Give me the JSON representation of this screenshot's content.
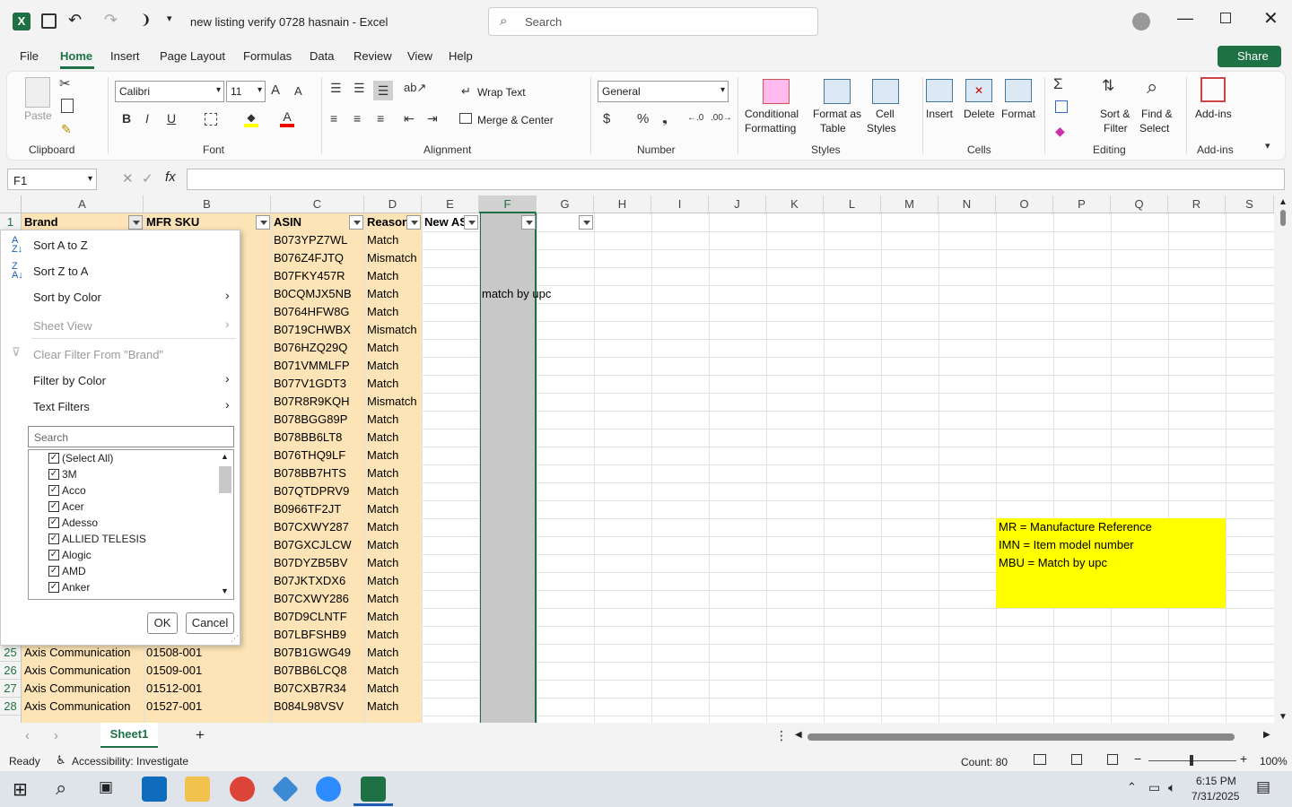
{
  "window": {
    "title": "new listing verify 0728 hasnain  -  Excel",
    "search_placeholder": "Search",
    "share_label": "Share"
  },
  "menu": [
    "File",
    "Home",
    "Insert",
    "Page Layout",
    "Formulas",
    "Data",
    "Review",
    "View",
    "Help"
  ],
  "ribbon": {
    "clipboard": {
      "label": "Clipboard",
      "paste": "Paste"
    },
    "font": {
      "label": "Font",
      "name": "Calibri",
      "size": "11"
    },
    "alignment": {
      "label": "Alignment",
      "wrap": "Wrap Text",
      "merge": "Merge & Center"
    },
    "number": {
      "label": "Number",
      "format": "General"
    },
    "styles": {
      "label": "Styles",
      "cond1": "Conditional",
      "cond2": "Formatting",
      "fmt1": "Format as",
      "fmt2": "Table",
      "cell1": "Cell",
      "cell2": "Styles"
    },
    "cells": {
      "label": "Cells",
      "insert": "Insert",
      "delete": "Delete",
      "format": "Format"
    },
    "editing": {
      "label": "Editing",
      "sort1": "Sort &",
      "sort2": "Filter",
      "find1": "Find &",
      "find2": "Select"
    },
    "addins": {
      "label": "Add-ins",
      "btn": "Add-ins"
    }
  },
  "formula": {
    "namebox": "F1",
    "content": ""
  },
  "columns": [
    "A",
    "B",
    "C",
    "D",
    "E",
    "F",
    "G",
    "H",
    "I",
    "J",
    "K",
    "L",
    "M",
    "N",
    "O",
    "P",
    "Q",
    "R",
    "S"
  ],
  "header_row": {
    "a": "Brand",
    "b": "MFR SKU",
    "c": "ASIN",
    "d": "Reason",
    "e": "New AS"
  },
  "rows_c": [
    "B073YPZ7WL",
    "B076Z4FJTQ",
    "B07FKY457R",
    "B0CQMJX5NB",
    "B0764HFW8G",
    "B0719CHWBX",
    "B076HZQ29Q",
    "B071VMMLFP",
    "B077V1GDT3",
    "B07R8R9KQH",
    "B078BGG89P",
    "B078BB6LT8",
    "B076THQ9LF",
    "B078BB7HTS",
    "B07QTDPRV9",
    "B0966TF2JT",
    "B07CXWY287",
    "B07GXCJLCW",
    "B07DYZB5BV",
    "B07JKTXDX6",
    "B07CXWY286",
    "B07D9CLNTF",
    "B07LBFSHB9",
    "B07B1GWG49",
    "B07BB6LCQ8",
    "B07CXB7R34",
    "B084L98VSV"
  ],
  "rows_d": [
    "Match",
    "Mismatch",
    "Match",
    "Match",
    "Match",
    "Mismatch",
    "Match",
    "Match",
    "Match",
    "Mismatch",
    "Match",
    "Match",
    "Match",
    "Match",
    "Match",
    "Match",
    "Match",
    "Match",
    "Match",
    "Match",
    "Match",
    "Match",
    "Match",
    "Match",
    "Match",
    "Match",
    "Match"
  ],
  "visible_rows": [
    {
      "num": "25",
      "a": "Axis Communication",
      "b": "01508-001"
    },
    {
      "num": "26",
      "a": "Axis Communication",
      "b": "01509-001"
    },
    {
      "num": "27",
      "a": "Axis Communication",
      "b": "01512-001"
    },
    {
      "num": "28",
      "a": "Axis Communication",
      "b": "01527-001"
    }
  ],
  "f4_note": "match by upc",
  "legend": [
    "MR = Manufacture Reference",
    "IMN = Item model number",
    "MBU = Match by upc"
  ],
  "dropdown": {
    "sort_az": "Sort A to Z",
    "sort_za": "Sort Z to A",
    "sort_color": "Sort by Color",
    "sheet_view": "Sheet View",
    "clear_filter": "Clear Filter From \"Brand\"",
    "filter_color": "Filter by Color",
    "text_filters": "Text Filters",
    "search_placeholder": "Search",
    "values": [
      "(Select All)",
      "3M",
      "Acco",
      "Acer",
      "Adesso",
      "ALLIED TELESIS",
      "Alogic",
      "AMD",
      "Anker"
    ],
    "ok": "OK",
    "cancel": "Cancel"
  },
  "sheet": {
    "tab": "Sheet1"
  },
  "status": {
    "ready": "Ready",
    "accessibility": "Accessibility: Investigate",
    "count": "Count: 80",
    "zoom": "100%"
  },
  "clock": {
    "time": "6:15 PM",
    "date": "7/31/2025"
  },
  "colors": {
    "excel_green": "#1e7145",
    "peach": "#fce4b6",
    "yellow": "#ffff00",
    "selected_col": "#c8c8c8"
  }
}
